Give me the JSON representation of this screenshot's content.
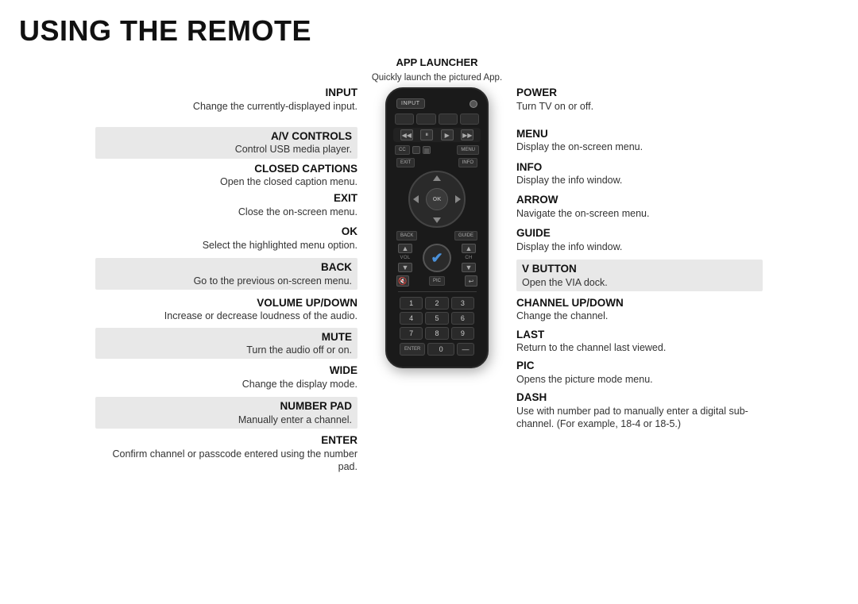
{
  "title": "USING THE REMOTE",
  "app_launcher": {
    "label": "APP LAUNCHER",
    "desc": "Quickly launch the pictured App."
  },
  "left_items": [
    {
      "id": "input",
      "label": "INPUT",
      "desc": "Change the currently-displayed input.",
      "shaded": false
    },
    {
      "id": "av_controls",
      "label": "A/V CONTROLS",
      "desc": "Control USB media player.",
      "shaded": true
    },
    {
      "id": "closed_captions",
      "label": "CLOSED CAPTIONS",
      "desc": "Open the closed caption menu.",
      "shaded": false
    },
    {
      "id": "exit",
      "label": "EXIT",
      "desc": "Close the on-screen menu.",
      "shaded": false
    },
    {
      "id": "ok",
      "label": "OK",
      "desc": "Select the highlighted menu option.",
      "shaded": false
    },
    {
      "id": "back",
      "label": "BACK",
      "desc": "Go to the previous on-screen menu.",
      "shaded": true
    },
    {
      "id": "volume_up_down",
      "label": "VOLUME UP/DOWN",
      "desc": "Increase or decrease loudness of the audio.",
      "shaded": false
    },
    {
      "id": "mute",
      "label": "MUTE",
      "desc": "Turn the audio off or on.",
      "shaded": true
    },
    {
      "id": "wide",
      "label": "WIDE",
      "desc": "Change the display mode.",
      "shaded": false
    },
    {
      "id": "number_pad",
      "label": "NUMBER PAD",
      "desc": "Manually enter a channel.",
      "shaded": true
    },
    {
      "id": "enter",
      "label": "ENTER",
      "desc": "Confirm channel or passcode entered using the number pad.",
      "shaded": false
    }
  ],
  "right_items": [
    {
      "id": "power",
      "label": "POWER",
      "desc": "Turn TV on or off.",
      "shaded": false
    },
    {
      "id": "menu",
      "label": "MENU",
      "desc": "Display the on-screen menu.",
      "shaded": false
    },
    {
      "id": "info",
      "label": "INFO",
      "desc": "Display the info window.",
      "shaded": false
    },
    {
      "id": "arrow",
      "label": "ARROW",
      "desc": "Navigate the on-screen menu.",
      "shaded": false
    },
    {
      "id": "guide",
      "label": "GUIDE",
      "desc": "Display the info window.",
      "shaded": false
    },
    {
      "id": "v_button",
      "label": "V BUTTON",
      "desc": "Open the VIA dock.",
      "shaded": true
    },
    {
      "id": "channel_up_down",
      "label": "CHANNEL UP/DOWN",
      "desc": "Change the channel.",
      "shaded": false
    },
    {
      "id": "last",
      "label": "LAST",
      "desc": "Return to the channel last viewed.",
      "shaded": false
    },
    {
      "id": "pic",
      "label": "PIC",
      "desc": "Opens the picture mode menu.",
      "shaded": false
    },
    {
      "id": "dash",
      "label": "DASH",
      "desc": "Use with number pad to manually enter a digital sub-channel. (For example, 18-4 or 18-5.)",
      "shaded": false
    }
  ],
  "remote": {
    "input_label": "INPUT",
    "cc_label": "CC",
    "menu_label": "MENU",
    "exit_label": "EXIT",
    "info_label": "INFO",
    "ok_label": "OK",
    "back_label": "BACK",
    "guide_label": "GUIDE",
    "vol_label": "VOL",
    "ch_label": "CH",
    "pic_label": "PIC",
    "enter_label": "ENTER",
    "numbers": [
      "1",
      "2",
      "3",
      "4",
      "5",
      "6",
      "7",
      "8",
      "9"
    ],
    "zero": "0"
  }
}
